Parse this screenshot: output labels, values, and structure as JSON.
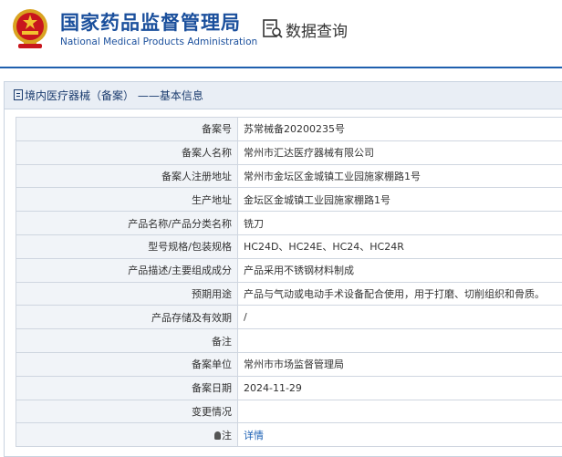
{
  "header": {
    "org_name_cn": "国家药品监督管理局",
    "org_name_en": "National Medical Products Administration",
    "query_label": "数据查询",
    "brand_color": "#1a4f9c",
    "emblem_icon": "national-emblem-icon",
    "query_icon": "data-query-icon"
  },
  "panel": {
    "title": "境内医疗器械（备案）  ——基本信息",
    "rows": [
      {
        "label": "备案号",
        "value": "苏常械备20200235号"
      },
      {
        "label": "备案人名称",
        "value": "常州市汇达医疗器械有限公司"
      },
      {
        "label": "备案人注册地址",
        "value": "常州市金坛区金城镇工业园施家棚路1号"
      },
      {
        "label": "生产地址",
        "value": "金坛区金城镇工业园施家棚路1号"
      },
      {
        "label": "产品名称/产品分类名称",
        "value": "铣刀"
      },
      {
        "label": "型号规格/包装规格",
        "value": "HC24D、HC24E、HC24、HC24R"
      },
      {
        "label": "产品描述/主要组成成分",
        "value": "产品采用不锈钢材料制成"
      },
      {
        "label": "预期用途",
        "value": "产品与气动或电动手术设备配合使用，用于打磨、切削组织和骨质。"
      },
      {
        "label": "产品存储及有效期",
        "value": "/"
      },
      {
        "label": "备注",
        "value": ""
      },
      {
        "label": "备案单位",
        "value": "常州市市场监督管理局"
      },
      {
        "label": "备案日期",
        "value": "2024-11-29"
      },
      {
        "label": "变更情况",
        "value": ""
      },
      {
        "label": "注",
        "value": "详情"
      }
    ]
  }
}
